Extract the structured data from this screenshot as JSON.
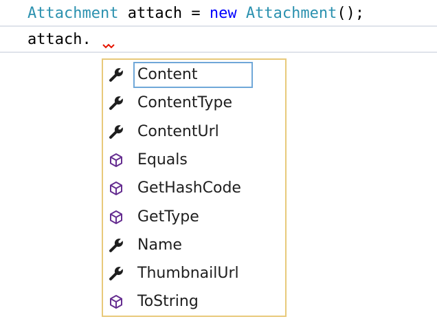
{
  "code": {
    "line1": {
      "type_name": "Attachment",
      "variable": " attach = ",
      "keyword": "new",
      "space": " ",
      "constructor": "Attachment",
      "tail": "();"
    },
    "line2": {
      "text": "attach."
    }
  },
  "colors": {
    "type_name": "#2b91af",
    "keyword": "#0000ff",
    "popup_border": "#e8c97a",
    "selection_border": "#6fa7d8",
    "property_icon": "#1e1e1e",
    "method_icon": "#652d90",
    "squiggle": "#e51400"
  },
  "completion": {
    "selected_index": 0,
    "items": [
      {
        "label": "Content",
        "icon": "wrench-icon"
      },
      {
        "label": "ContentType",
        "icon": "wrench-icon"
      },
      {
        "label": "ContentUrl",
        "icon": "wrench-icon"
      },
      {
        "label": "Equals",
        "icon": "method-cube-icon"
      },
      {
        "label": "GetHashCode",
        "icon": "method-cube-icon"
      },
      {
        "label": "GetType",
        "icon": "method-cube-icon"
      },
      {
        "label": "Name",
        "icon": "wrench-icon"
      },
      {
        "label": "ThumbnailUrl",
        "icon": "wrench-icon"
      },
      {
        "label": "ToString",
        "icon": "method-cube-icon"
      }
    ]
  }
}
